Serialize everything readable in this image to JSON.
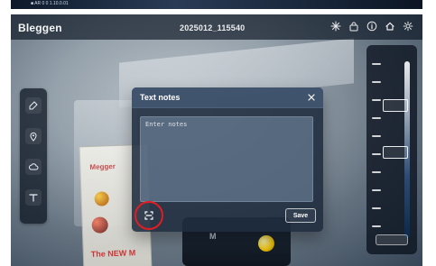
{
  "top_strip": {
    "mini_text": "■ AR 0 0 1.10.0.01"
  },
  "camera_overlay": {
    "brand": "Bleggen",
    "timestamp": "2025012_115540",
    "header_icons": [
      "snowflake-icon",
      "lock-icon",
      "info-icon",
      "home-icon",
      "settings-icon"
    ]
  },
  "left_dock": {
    "items": [
      {
        "name": "capture-tool-button",
        "icon": "capture-icon"
      },
      {
        "name": "pin-tool-button",
        "icon": "pin-icon"
      },
      {
        "name": "cloud-tool-button",
        "icon": "cloud-icon"
      },
      {
        "name": "text-tool-button",
        "icon": "text-icon"
      }
    ]
  },
  "modal": {
    "title": "Text notes",
    "placeholder": "Enter notes",
    "save_label": "Save",
    "close_icon": "close-icon",
    "scan_icon": "scan-icon"
  },
  "background": {
    "poster_brand": "Megger",
    "poster_text": "The NEW M"
  },
  "scale": {
    "markers": [
      "marker-1",
      "marker-2"
    ]
  }
}
